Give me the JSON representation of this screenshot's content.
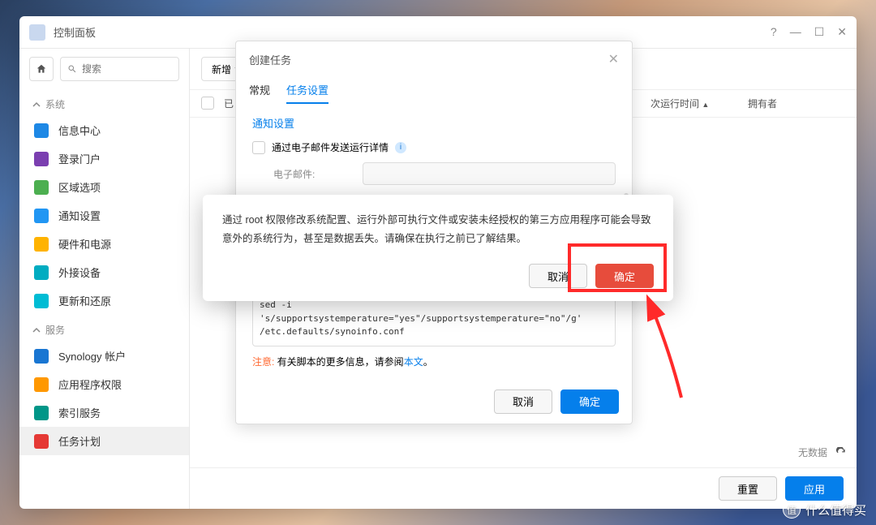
{
  "window": {
    "title": "控制面板"
  },
  "search": {
    "placeholder": "搜索"
  },
  "sidebar": {
    "sections": [
      {
        "label": "系统",
        "items": [
          {
            "label": "信息中心",
            "color": "#1e88e5"
          },
          {
            "label": "登录门户",
            "color": "#7b3fb0"
          },
          {
            "label": "区域选项",
            "color": "#4caf50"
          },
          {
            "label": "通知设置",
            "color": "#2196f3"
          },
          {
            "label": "硬件和电源",
            "color": "#ffb300"
          },
          {
            "label": "外接设备",
            "color": "#00acc1"
          },
          {
            "label": "更新和还原",
            "color": "#00bcd4"
          }
        ]
      },
      {
        "label": "服务",
        "items": [
          {
            "label": "Synology 帐户",
            "color": "#1976d2"
          },
          {
            "label": "应用程序权限",
            "color": "#ff9800"
          },
          {
            "label": "索引服务",
            "color": "#009688"
          },
          {
            "label": "任务计划",
            "color": "#e53935",
            "active": true
          }
        ]
      }
    ]
  },
  "toolbar": {
    "new": "新增"
  },
  "table": {
    "cols": {
      "enabled": "已",
      "next_run": "次运行时间",
      "owner": "拥有者"
    },
    "no_data": "无数据"
  },
  "footer": {
    "reset": "重置",
    "apply": "应用"
  },
  "modal": {
    "title": "创建任务",
    "tabs": {
      "general": "常规",
      "settings": "任务设置"
    },
    "section_notify": "通知设置",
    "check_email": "通过电子邮件发送运行详情",
    "email_label": "电子邮件:",
    "script": "'s/supportsystempwarning=\"yes\"/supportsystempwarning=\"no\"/g' /etc.defaults/synoinfo.conf\nsed -i\n's/supportsystemperature=\"yes\"/supportsystemperature=\"no\"/g' /etc.defaults/synoinfo.conf",
    "note_label": "注意:",
    "note_text": " 有关脚本的更多信息，请参阅",
    "note_link": "本文",
    "note_period": "。",
    "cancel": "取消",
    "ok": "确定"
  },
  "confirm": {
    "text": "通过 root 权限修改系统配置、运行外部可执行文件或安装未经授权的第三方应用程序可能会导致意外的系统行为，甚至是数据丢失。请确保在执行之前已了解结果。",
    "cancel": "取消",
    "ok": "确定"
  },
  "watermark": {
    "text": "什么值得买",
    "badge": "值"
  }
}
